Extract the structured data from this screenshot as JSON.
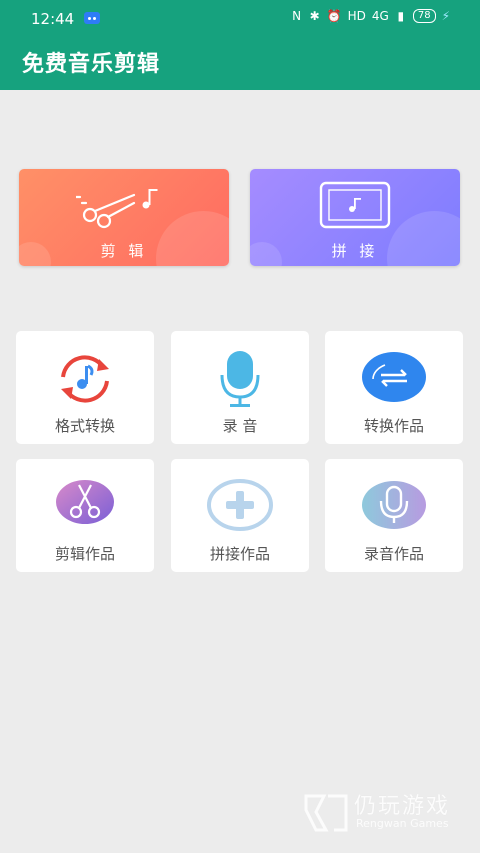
{
  "status": {
    "time": "12:44",
    "icons": [
      "nfc-icon",
      "bluetooth-icon",
      "alarm-icon"
    ],
    "hd": "HD",
    "signal": "4G",
    "battery": "78"
  },
  "app": {
    "title": "免费音乐剪辑",
    "accent": "#16a27e"
  },
  "features": {
    "cut": {
      "label": "剪 辑"
    },
    "join": {
      "label": "拼 接"
    }
  },
  "tiles": [
    {
      "label": "格式转换"
    },
    {
      "label": "录 音"
    },
    {
      "label": "转换作品"
    },
    {
      "label": "剪辑作品"
    },
    {
      "label": "拼接作品"
    },
    {
      "label": "录音作品"
    }
  ],
  "watermark": {
    "cn": "仍玩游戏",
    "en": "Rengwan Games"
  }
}
